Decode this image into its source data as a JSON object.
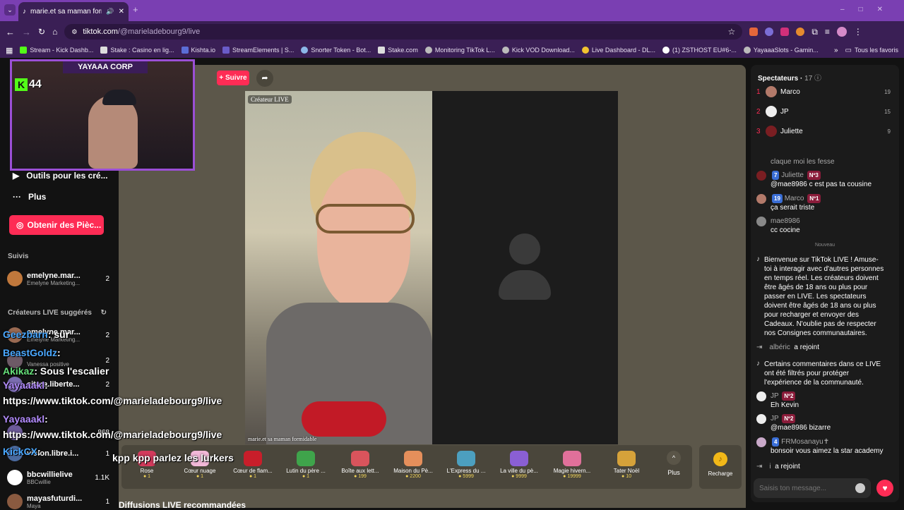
{
  "browser": {
    "tab_title": "marie.et sa maman formida",
    "url_host": "tiktok.com",
    "url_path": "/@marieladebourg9/live",
    "bookmarks": [
      "Stream - Kick Dashb...",
      "Stake : Casino en lig...",
      "Kishta.io",
      "StreamElements | S...",
      "Snorter Token - Bot...",
      "Stake.com",
      "Monitoring TikTok L...",
      "Kick VOD Download...",
      "Live Dashboard - DL...",
      "(1) ZSTHOST EU#6-...",
      "YayaaaSlots - Gamin..."
    ],
    "all_favorites": "Tous les favoris"
  },
  "sidebar": {
    "tools": "Outils pour les cré...",
    "more": "Plus",
    "get_coins": "Obtenir des Pièc...",
    "followed_title": "Suivis",
    "followed": [
      {
        "name": "emelyne.mar...",
        "sub": "Emelyne Marketing...",
        "count": "2"
      }
    ],
    "suggested_title": "Créateurs LIVE suggérés",
    "suggested": [
      {
        "name": "emelyne.mar...",
        "sub": "Emelyne Marketing...",
        "count": "2"
      },
      {
        "name": "",
        "sub": "Vanessa positive",
        "count": "2"
      },
      {
        "name": "sitara.liberte...",
        "sub": "",
        "count": "2"
      },
      {
        "name": "",
        "sub": "",
        "count": "868"
      },
      {
        "name": "vision.libre.i...",
        "sub": "",
        "count": "1"
      },
      {
        "name": "bbcwillielive",
        "sub": "BBCwillie",
        "count": "1.1K"
      },
      {
        "name": "mayasfuturdi...",
        "sub": "Maya",
        "count": "1"
      }
    ]
  },
  "live": {
    "follow_label": "+ Suivre",
    "creator_badge": "Créateur LIVE",
    "video_caption": "marie.et sa maman formidable",
    "recommended": "Diffusions LIVE recommandées"
  },
  "overlay": {
    "title": "YAYAAA CORP",
    "viewer_count": "44",
    "chat": [
      {
        "user": "Geezbarn",
        "msg": ": sur"
      },
      {
        "user": "BeastGoldz",
        "msg": ":"
      },
      {
        "user": "Akikaz",
        "msg": ": Sous l'escalier"
      },
      {
        "user": "Yayaaakl",
        "msg": ":"
      },
      {
        "user": "",
        "msg": "https://www.tiktok.com/@marieladebourg9/live"
      },
      {
        "user": "Yayaaakl",
        "msg": ":"
      },
      {
        "user": "",
        "msg": "https://www.tiktok.com/@marieladebourg9/live"
      },
      {
        "user": "KickCX",
        "msg": ":"
      }
    ],
    "bottom_msg": "kpp kpp parlez les lurkers"
  },
  "gifts": [
    {
      "name": "Rose",
      "price": "1",
      "color": "#d33a5c"
    },
    {
      "name": "Cœur nuage",
      "price": "1",
      "color": "#f2b8d8"
    },
    {
      "name": "Cœur de flam...",
      "price": "1",
      "color": "#c81e2a"
    },
    {
      "name": "Lutin du père ...",
      "price": "1",
      "color": "#3fa44b"
    },
    {
      "name": "Boîte aux lett...",
      "price": "199",
      "color": "#d9545c"
    },
    {
      "name": "Maison du Pè...",
      "price": "2200",
      "color": "#e58f5b"
    },
    {
      "name": "L'Express du ...",
      "price": "5999",
      "color": "#4c9fbf"
    },
    {
      "name": "La ville du pè...",
      "price": "9999",
      "color": "#8a5fd4"
    },
    {
      "name": "Magie hivern...",
      "price": "19999",
      "color": "#e0709a"
    },
    {
      "name": "Tater Noël",
      "price": "10",
      "color": "#d6a23a"
    }
  ],
  "gift_more": "Plus",
  "recharge": "Recharge",
  "right": {
    "viewers_title": "Spectateurs",
    "viewers_count": "17",
    "top": [
      {
        "rank": "1",
        "name": "Marco",
        "score": "19"
      },
      {
        "rank": "2",
        "name": "JP",
        "score": "15"
      },
      {
        "rank": "3",
        "name": "Juliette",
        "score": "9"
      }
    ],
    "chat": [
      {
        "type": "plain",
        "text": "claque moi les fesse"
      },
      {
        "type": "msg",
        "user": "Juliette",
        "lvl": "7",
        "badge": "Nº3",
        "text": "@mae8986 c est pas ta cousine"
      },
      {
        "type": "msg",
        "user": "Marco",
        "lvl": "19",
        "badge": "Nº1",
        "text": "ça serait triste"
      },
      {
        "type": "msg",
        "user": "mae8986",
        "lvl": "",
        "badge": "",
        "text": "cc cocine"
      }
    ],
    "new_label": "Nouveau",
    "welcome": "Bienvenue sur TikTok LIVE ! Amuse-toi à interagir avec d'autres personnes en temps réel. Les créateurs doivent être âgés de 18 ans ou plus pour passer en LIVE. Les spectateurs doivent être âgés de 18 ans ou plus pour recharger et envoyer des Cadeaux. N'oublie pas de respecter nos Consignes communautaires.",
    "join1_user": "albéric",
    "join1_text": "a rejoint",
    "filter_notice": "Certains commentaires dans ce LIVE ont été filtrés pour protéger l'expérience de la communauté.",
    "chat2": [
      {
        "user": "JP",
        "badge": "Nº2",
        "text": "Eh Kevin"
      },
      {
        "user": "JP",
        "badge": "Nº2",
        "text": "@mae8986 bizarre"
      },
      {
        "user": "FRMosanayu✝",
        "badge": "",
        "lvl": "4",
        "text": "bonsoir vous aimez la star academy"
      }
    ],
    "join2_user": "i",
    "join2_text": "a rejoint",
    "input_placeholder": "Saisis ton message..."
  }
}
